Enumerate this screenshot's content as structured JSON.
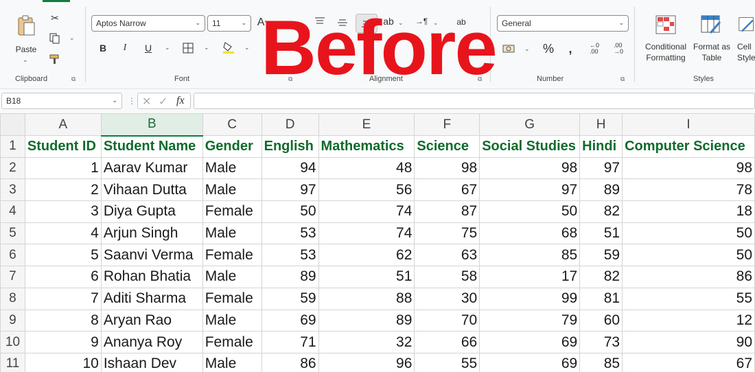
{
  "ribbon": {
    "clipboard": {
      "paste_label": "Paste",
      "group_label": "Clipboard"
    },
    "font": {
      "font_name": "Aptos Narrow",
      "font_size": "11",
      "group_label": "Font"
    },
    "alignment": {
      "group_label": "Alignment"
    },
    "number": {
      "format": "General",
      "group_label": "Number"
    },
    "styles": {
      "conditional_formatting_line1": "Conditional",
      "conditional_formatting_line2": "Formatting",
      "format_as_table_line1": "Format as",
      "format_as_table_line2": "Table",
      "cell_styles_line1": "Cell",
      "cell_styles_line2": "Styles",
      "group_label": "Styles"
    }
  },
  "overlay": {
    "title": "Before",
    "color": "#e8141c"
  },
  "formula_bar": {
    "name_box": "B18",
    "fx_label": "fx",
    "formula": ""
  },
  "grid": {
    "col_headers": [
      "A",
      "B",
      "C",
      "D",
      "E",
      "F",
      "G",
      "H",
      "I"
    ],
    "selected_col": "B",
    "row_numbers": [
      "1",
      "2",
      "3",
      "4",
      "5",
      "6",
      "7",
      "8",
      "9",
      "10",
      "11"
    ],
    "header_cells": [
      "Student ID",
      "Student Name",
      "Gender",
      "English",
      "Mathematics",
      "Science",
      "Social Studies",
      "Hindi",
      "Computer Science"
    ],
    "rows": [
      [
        "1",
        "Aarav Kumar",
        "Male",
        "94",
        "48",
        "98",
        "98",
        "97",
        "98"
      ],
      [
        "2",
        "Vihaan Dutta",
        "Male",
        "97",
        "56",
        "67",
        "97",
        "89",
        "78"
      ],
      [
        "3",
        "Diya Gupta",
        "Female",
        "50",
        "74",
        "87",
        "50",
        "82",
        "18"
      ],
      [
        "4",
        "Arjun Singh",
        "Male",
        "53",
        "74",
        "75",
        "68",
        "51",
        "50"
      ],
      [
        "5",
        "Saanvi Verma",
        "Female",
        "53",
        "62",
        "63",
        "85",
        "59",
        "50"
      ],
      [
        "6",
        "Rohan Bhatia",
        "Male",
        "89",
        "51",
        "58",
        "17",
        "82",
        "86"
      ],
      [
        "7",
        "Aditi Sharma",
        "Female",
        "59",
        "88",
        "30",
        "99",
        "81",
        "55"
      ],
      [
        "8",
        "Aryan Rao",
        "Male",
        "69",
        "89",
        "70",
        "79",
        "60",
        "12"
      ],
      [
        "9",
        "Ananya Roy",
        "Female",
        "71",
        "32",
        "66",
        "69",
        "73",
        "90"
      ],
      [
        "10",
        "Ishaan Dev",
        "Male",
        "86",
        "96",
        "55",
        "69",
        "85",
        "67"
      ]
    ]
  },
  "colors": {
    "header_text": "#0f6b2b",
    "accent": "#107c41"
  }
}
